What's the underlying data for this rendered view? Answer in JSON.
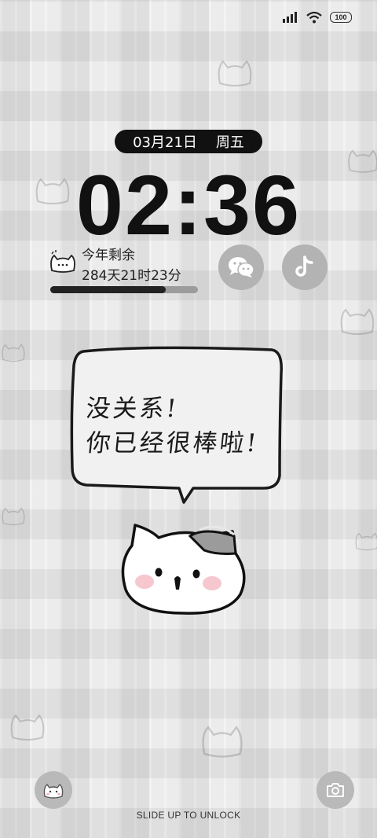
{
  "status": {
    "battery": "100"
  },
  "date": {
    "day": "03月21日",
    "weekday": "周五"
  },
  "time": "02:36",
  "year_widget": {
    "title": "今年剩余",
    "remaining": "284天21时23分",
    "progress_fraction": 0.78
  },
  "apps": {
    "left_icon": "wechat-icon",
    "right_icon": "tiktok-icon"
  },
  "bubble": {
    "line1": "没关系!",
    "line2": "你已经很棒啦!"
  },
  "bottom": {
    "unlock_text": "SLIDE UP TO UNLOCK"
  },
  "colors": {
    "accent": "#111111",
    "button_bg": "#b3b3b3"
  }
}
